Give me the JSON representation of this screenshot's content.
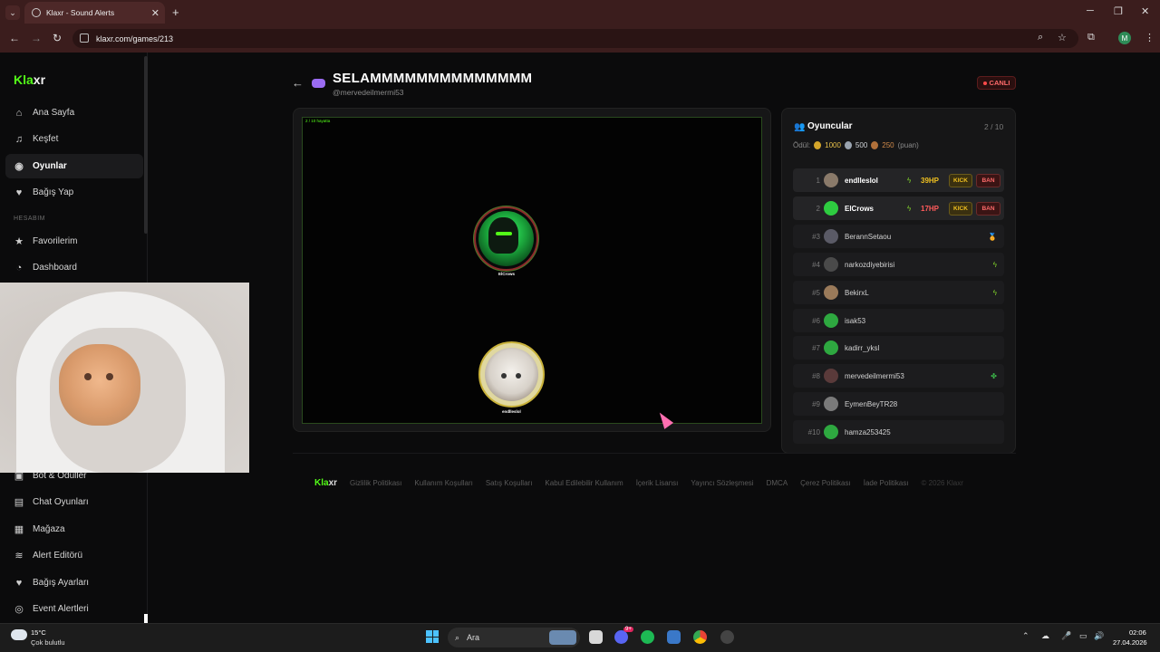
{
  "browser": {
    "tab_title": "Klaxr - Sound Alerts",
    "url": "klaxr.com/games/213",
    "profile_initial": "M"
  },
  "sidebar": {
    "logo_a": "Kla",
    "logo_b": "xr",
    "items": [
      {
        "label": "Ana Sayfa",
        "icon": "home-icon"
      },
      {
        "label": "Keşfet",
        "icon": "music-icon"
      },
      {
        "label": "Oyunlar",
        "icon": "gamepad-icon"
      },
      {
        "label": "Bağış Yap",
        "icon": "heart-icon"
      }
    ],
    "section_label": "HESABIM",
    "account_items": [
      {
        "label": "Favorilerim",
        "icon": "star-icon"
      },
      {
        "label": "Dashboard",
        "icon": "dashboard-icon"
      },
      {
        "label": "Bot & Ödüller",
        "icon": "bot-icon"
      },
      {
        "label": "Chat Oyunları",
        "icon": "chat-icon"
      },
      {
        "label": "Mağaza",
        "icon": "store-icon"
      },
      {
        "label": "Alert Editörü",
        "icon": "layers-icon"
      },
      {
        "label": "Bağış Ayarları",
        "icon": "heart-icon"
      },
      {
        "label": "Event Alertleri",
        "icon": "target-icon"
      }
    ]
  },
  "header": {
    "title": "SELAMMMMMMMMMMMMMM",
    "username": "@mervedeilmermi53",
    "live_label": "CANLI"
  },
  "game": {
    "hud_text": "2 / 10 hayatta",
    "player1_name": "ElCrows",
    "player2_name": "endlleslol"
  },
  "players_panel": {
    "title": "Oyuncular",
    "count": "2 / 10",
    "reward_label": "Ödül:",
    "reward_gold": "1000",
    "reward_silver": "500",
    "reward_bronze": "250",
    "reward_unit": "(puan)",
    "kick_label": "KICK",
    "ban_label": "BAN",
    "rows": [
      {
        "rank": "1",
        "name": "endlleslol",
        "hp": "39HP"
      },
      {
        "rank": "2",
        "name": "ElCrows",
        "hp": "17HP"
      },
      {
        "rank": "#3",
        "name": "BerannSetaou",
        "icon": "bronze-medal-icon"
      },
      {
        "rank": "#4",
        "name": "narkozdiyebirisi",
        "icon": "lightning-icon"
      },
      {
        "rank": "#5",
        "name": "BekirxL",
        "icon": "lightning-icon"
      },
      {
        "rank": "#6",
        "name": "isak53"
      },
      {
        "rank": "#7",
        "name": "kadirr_yksl"
      },
      {
        "rank": "#8",
        "name": "mervedeilmermi53",
        "icon": "cactus-icon"
      },
      {
        "rank": "#9",
        "name": "EymenBeyTR28"
      },
      {
        "rank": "#10",
        "name": "hamza253425"
      }
    ]
  },
  "footer": {
    "logo_a": "Kla",
    "logo_b": "xr",
    "links": [
      "Gizlilik Politikası",
      "Kullanım Koşulları",
      "Satış Koşulları",
      "Kabul Edilebilir Kullanım",
      "İçerik Lisansı",
      "Yayıncı Sözleşmesi",
      "DMCA",
      "Çerez Politikası",
      "İade Politikası"
    ],
    "copyright": "© 2026 Klaxr"
  },
  "taskbar": {
    "temp": "15°C",
    "weather": "Çok bulutlu",
    "search_placeholder": "Ara",
    "discord_badge": "9+",
    "time": "02:06",
    "date": "27.04.2026"
  },
  "colors": {
    "accent": "#53fc18",
    "live": "#ff4a4a",
    "hp_yellow": "#f0c020",
    "hp_red": "#ff5a5a"
  }
}
